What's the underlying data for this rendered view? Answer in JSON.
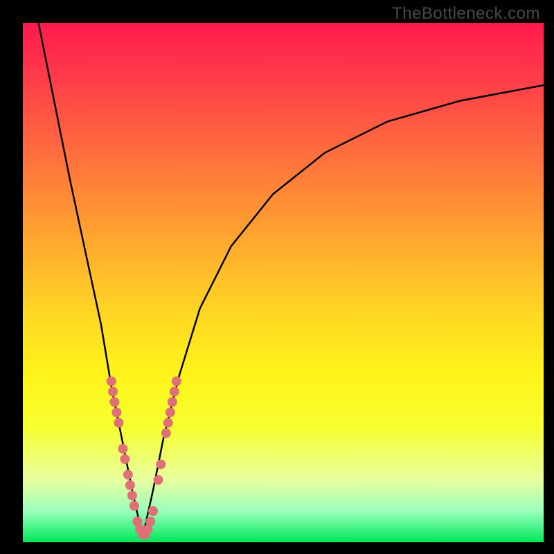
{
  "watermark": "TheBottleneck.com",
  "chart_data": {
    "type": "line",
    "title": "",
    "xlabel": "",
    "ylabel": "",
    "xlim": [
      0,
      100
    ],
    "ylim": [
      0,
      100
    ],
    "x_optimum": 23,
    "series": [
      {
        "name": "left-branch",
        "x": [
          3,
          6,
          9,
          12,
          15,
          17,
          19,
          21,
          23
        ],
        "y": [
          100,
          85,
          70,
          56,
          42,
          30,
          20,
          10,
          1
        ]
      },
      {
        "name": "right-branch",
        "x": [
          23,
          25,
          27,
          30,
          34,
          40,
          48,
          58,
          70,
          84,
          100
        ],
        "y": [
          1,
          10,
          20,
          32,
          45,
          57,
          67,
          75,
          81,
          85,
          88
        ]
      }
    ],
    "markers": [
      {
        "name": "left-cluster",
        "color": "#e07078",
        "points": [
          {
            "x": 17.0,
            "y": 31
          },
          {
            "x": 17.3,
            "y": 29
          },
          {
            "x": 17.6,
            "y": 27
          },
          {
            "x": 18.0,
            "y": 25
          },
          {
            "x": 18.4,
            "y": 23
          },
          {
            "x": 19.2,
            "y": 18
          },
          {
            "x": 19.6,
            "y": 16
          },
          {
            "x": 20.2,
            "y": 13
          },
          {
            "x": 20.6,
            "y": 11
          },
          {
            "x": 21.0,
            "y": 9
          },
          {
            "x": 21.4,
            "y": 7
          },
          {
            "x": 22.0,
            "y": 4
          },
          {
            "x": 22.5,
            "y": 2.5
          },
          {
            "x": 23.0,
            "y": 1.5
          }
        ]
      },
      {
        "name": "right-cluster",
        "color": "#e07078",
        "points": [
          {
            "x": 23.5,
            "y": 1.5
          },
          {
            "x": 24.0,
            "y": 2.5
          },
          {
            "x": 24.5,
            "y": 4
          },
          {
            "x": 25.0,
            "y": 6
          },
          {
            "x": 26.0,
            "y": 12
          },
          {
            "x": 26.5,
            "y": 15
          },
          {
            "x": 27.5,
            "y": 21
          },
          {
            "x": 27.9,
            "y": 23
          },
          {
            "x": 28.3,
            "y": 25
          },
          {
            "x": 28.7,
            "y": 27
          },
          {
            "x": 29.1,
            "y": 29
          },
          {
            "x": 29.5,
            "y": 31
          }
        ]
      }
    ]
  }
}
